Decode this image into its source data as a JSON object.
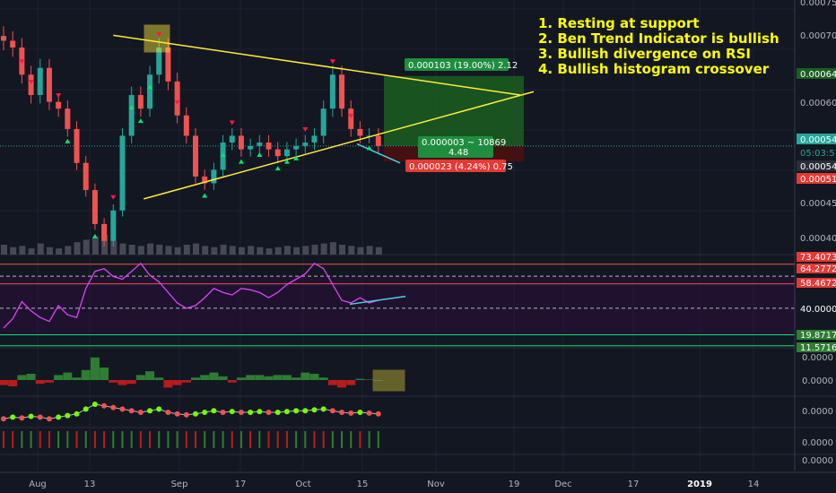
{
  "annotations": [
    "1. Resting at support",
    "2. Ben Trend Indicator is bullish",
    "3. Bullish divergence on RSI",
    "4. Bullish histogram crossover"
  ],
  "position": {
    "target_label": "0.000103 (19.00%) 2.12",
    "entry_label_1": "0.000003 ~ 10869",
    "entry_label_2": "4.48",
    "stop_label": "0.000023 (4.24%) 0.75"
  },
  "price_axis": {
    "ticks": [
      "0.000750",
      "0.000700",
      "0.000645",
      "0.000600",
      "0.000545",
      "05:03:51",
      "0.000542",
      "0.000519",
      "0.000450",
      "0.000400"
    ],
    "current_price": 0.000545
  },
  "rsi_axis": {
    "ticks": [
      "73.4073",
      "64.2772",
      "58.4672",
      "40.0000",
      "19.8717",
      "11.5716"
    ]
  },
  "hist_axis": {
    "ticks": [
      "0.0000",
      "0.0000"
    ]
  },
  "trend_axis": {
    "ticks": [
      "0.0000"
    ]
  },
  "extra_axis": {
    "ticks": [
      "0.0000",
      "0.0000"
    ]
  },
  "time_axis": {
    "ticks": [
      "Aug",
      "13",
      "Sep",
      "17",
      "Oct",
      "15",
      "Nov",
      "19",
      "Dec",
      "17",
      "2019",
      "14"
    ]
  },
  "colors": {
    "background": "#131722",
    "up": "#26a69a",
    "down": "#ef5350",
    "trendline": "#ffeb3b",
    "rsi": "#e040fb",
    "annotation": "#ffff00",
    "target": "#1b5e20",
    "stop": "#4a0f0f",
    "current_price": "#26a69a"
  },
  "chart_data": [
    {
      "type": "candlestick",
      "title": "",
      "series": [
        {
          "name": "",
          "close": [
            0.0007,
            0.00069,
            0.00065,
            0.00062,
            0.00066,
            0.00061,
            0.0006,
            0.00057,
            0.00052,
            0.00048,
            0.00043,
            0.000405,
            0.00045,
            0.00056,
            0.00062,
            0.0006,
            0.00065,
            0.00069,
            0.00064,
            0.00059,
            0.00056,
            0.0005,
            0.00049,
            0.00051,
            0.00055,
            0.00056,
            0.00054,
            0.000545,
            0.00055,
            0.00054,
            0.00053,
            0.00054,
            0.000545,
            0.00055,
            0.00056,
            0.0006,
            0.00065,
            0.0006,
            0.00057,
            0.00056,
            0.00056,
            0.000545
          ],
          "volume": [
            8,
            6,
            7,
            5,
            9,
            6,
            5,
            7,
            10,
            12,
            14,
            16,
            11,
            9,
            8,
            7,
            9,
            8,
            7,
            6,
            8,
            9,
            7,
            6,
            8,
            7,
            6,
            7,
            6,
            5,
            6,
            7,
            6,
            7,
            8,
            9,
            10,
            8,
            7,
            6,
            7,
            6
          ]
        }
      ],
      "ylim": [
        0.000385,
        0.00076
      ],
      "trendlines": [
        {
          "name": "upper",
          "from": [
            18,
            0.000708
          ],
          "to": [
            61,
            0.00062
          ]
        },
        {
          "name": "lower",
          "from": [
            23,
            0.000467
          ],
          "to": [
            62,
            0.00062
          ]
        }
      ],
      "long_position": {
        "entry": 0.000545,
        "target": 0.000648,
        "stop": 0.000522
      }
    },
    {
      "type": "line",
      "title": "",
      "ylim": [
        10,
        80
      ],
      "levels": [
        73.4073,
        64.2772,
        58.4672,
        40.0,
        19.8717,
        11.5716
      ],
      "values": [
        25,
        32,
        45,
        38,
        33,
        30,
        42,
        35,
        33,
        55,
        68,
        70,
        64,
        62,
        68,
        74,
        65,
        60,
        52,
        44,
        40,
        42,
        48,
        55,
        52,
        50,
        55,
        54,
        52,
        48,
        52,
        58,
        62,
        66,
        74,
        70,
        58,
        46,
        44,
        48,
        44,
        46
      ]
    },
    {
      "type": "bar",
      "title": "",
      "ylim": [
        -1,
        1
      ],
      "values": [
        -0.2,
        -0.25,
        0.2,
        0.25,
        -0.15,
        -0.1,
        0.2,
        0.3,
        0.1,
        0.4,
        0.9,
        0.5,
        -0.1,
        -0.2,
        -0.15,
        0.2,
        0.35,
        0.1,
        -0.3,
        -0.2,
        -0.1,
        0.1,
        0.2,
        0.3,
        0.15,
        -0.1,
        0.1,
        0.2,
        0.2,
        0.15,
        0.2,
        0.2,
        0.1,
        0.3,
        0.25,
        0.1,
        -0.2,
        -0.3,
        -0.2,
        0.05,
        0.02,
        0.0
      ]
    },
    {
      "type": "line",
      "title": "",
      "ylim": [
        -1,
        1
      ],
      "values": [
        -0.4,
        -0.3,
        -0.35,
        -0.25,
        -0.3,
        -0.4,
        -0.3,
        -0.2,
        -0.1,
        0.2,
        0.5,
        0.4,
        0.3,
        0.2,
        0.1,
        0.0,
        0.1,
        0.2,
        0.0,
        -0.1,
        -0.15,
        -0.1,
        0.0,
        0.1,
        0.0,
        0.05,
        0.0,
        0.0,
        0.05,
        0.0,
        0.0,
        0.05,
        0.1,
        0.1,
        0.15,
        0.2,
        0.1,
        0.0,
        -0.05,
        0.0,
        -0.05,
        -0.1
      ],
      "signal_colors": [
        "#ef5350",
        "#76ff03"
      ]
    },
    {
      "type": "bar",
      "title": "",
      "values": [
        1,
        1,
        0,
        0,
        1,
        1,
        0,
        0,
        1,
        0,
        1,
        1,
        0,
        0,
        0,
        1,
        1,
        0,
        0,
        0,
        1,
        1,
        0,
        0,
        0,
        1,
        0,
        1,
        0,
        1,
        1,
        1,
        0,
        0,
        1,
        1,
        0,
        0,
        0,
        1,
        0,
        0
      ]
    }
  ]
}
